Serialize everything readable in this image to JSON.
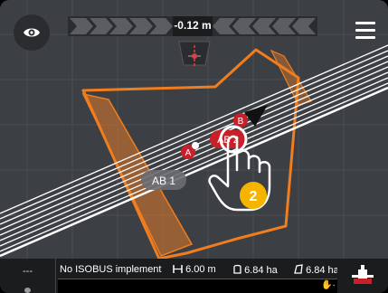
{
  "lightbar": {
    "offset": "-0.12 m"
  },
  "map": {
    "line_label": "AB 1",
    "point_a": "A",
    "point_b": "B",
    "ab_bubble": "AB 2",
    "step_badge": "2"
  },
  "status": {
    "left_value": "---",
    "implement": "No ISOBUS implement",
    "width": "6.00 m",
    "area_1": "6.84 ha",
    "area_2": "6.84 ha",
    "progress": 0.0
  },
  "colors": {
    "background": "#3c3f43",
    "boundary": "#f07d1e",
    "accent_red": "#c8202a",
    "badge_yellow": "#f5b400",
    "statusbar": "#1b1c1e"
  },
  "icons": {
    "eye": "eye-icon",
    "menu": "hamburger-menu-icon",
    "width": "width-icon",
    "area": "area-icon",
    "hand": "hand-touch-icon",
    "implement": "implement-icon"
  }
}
